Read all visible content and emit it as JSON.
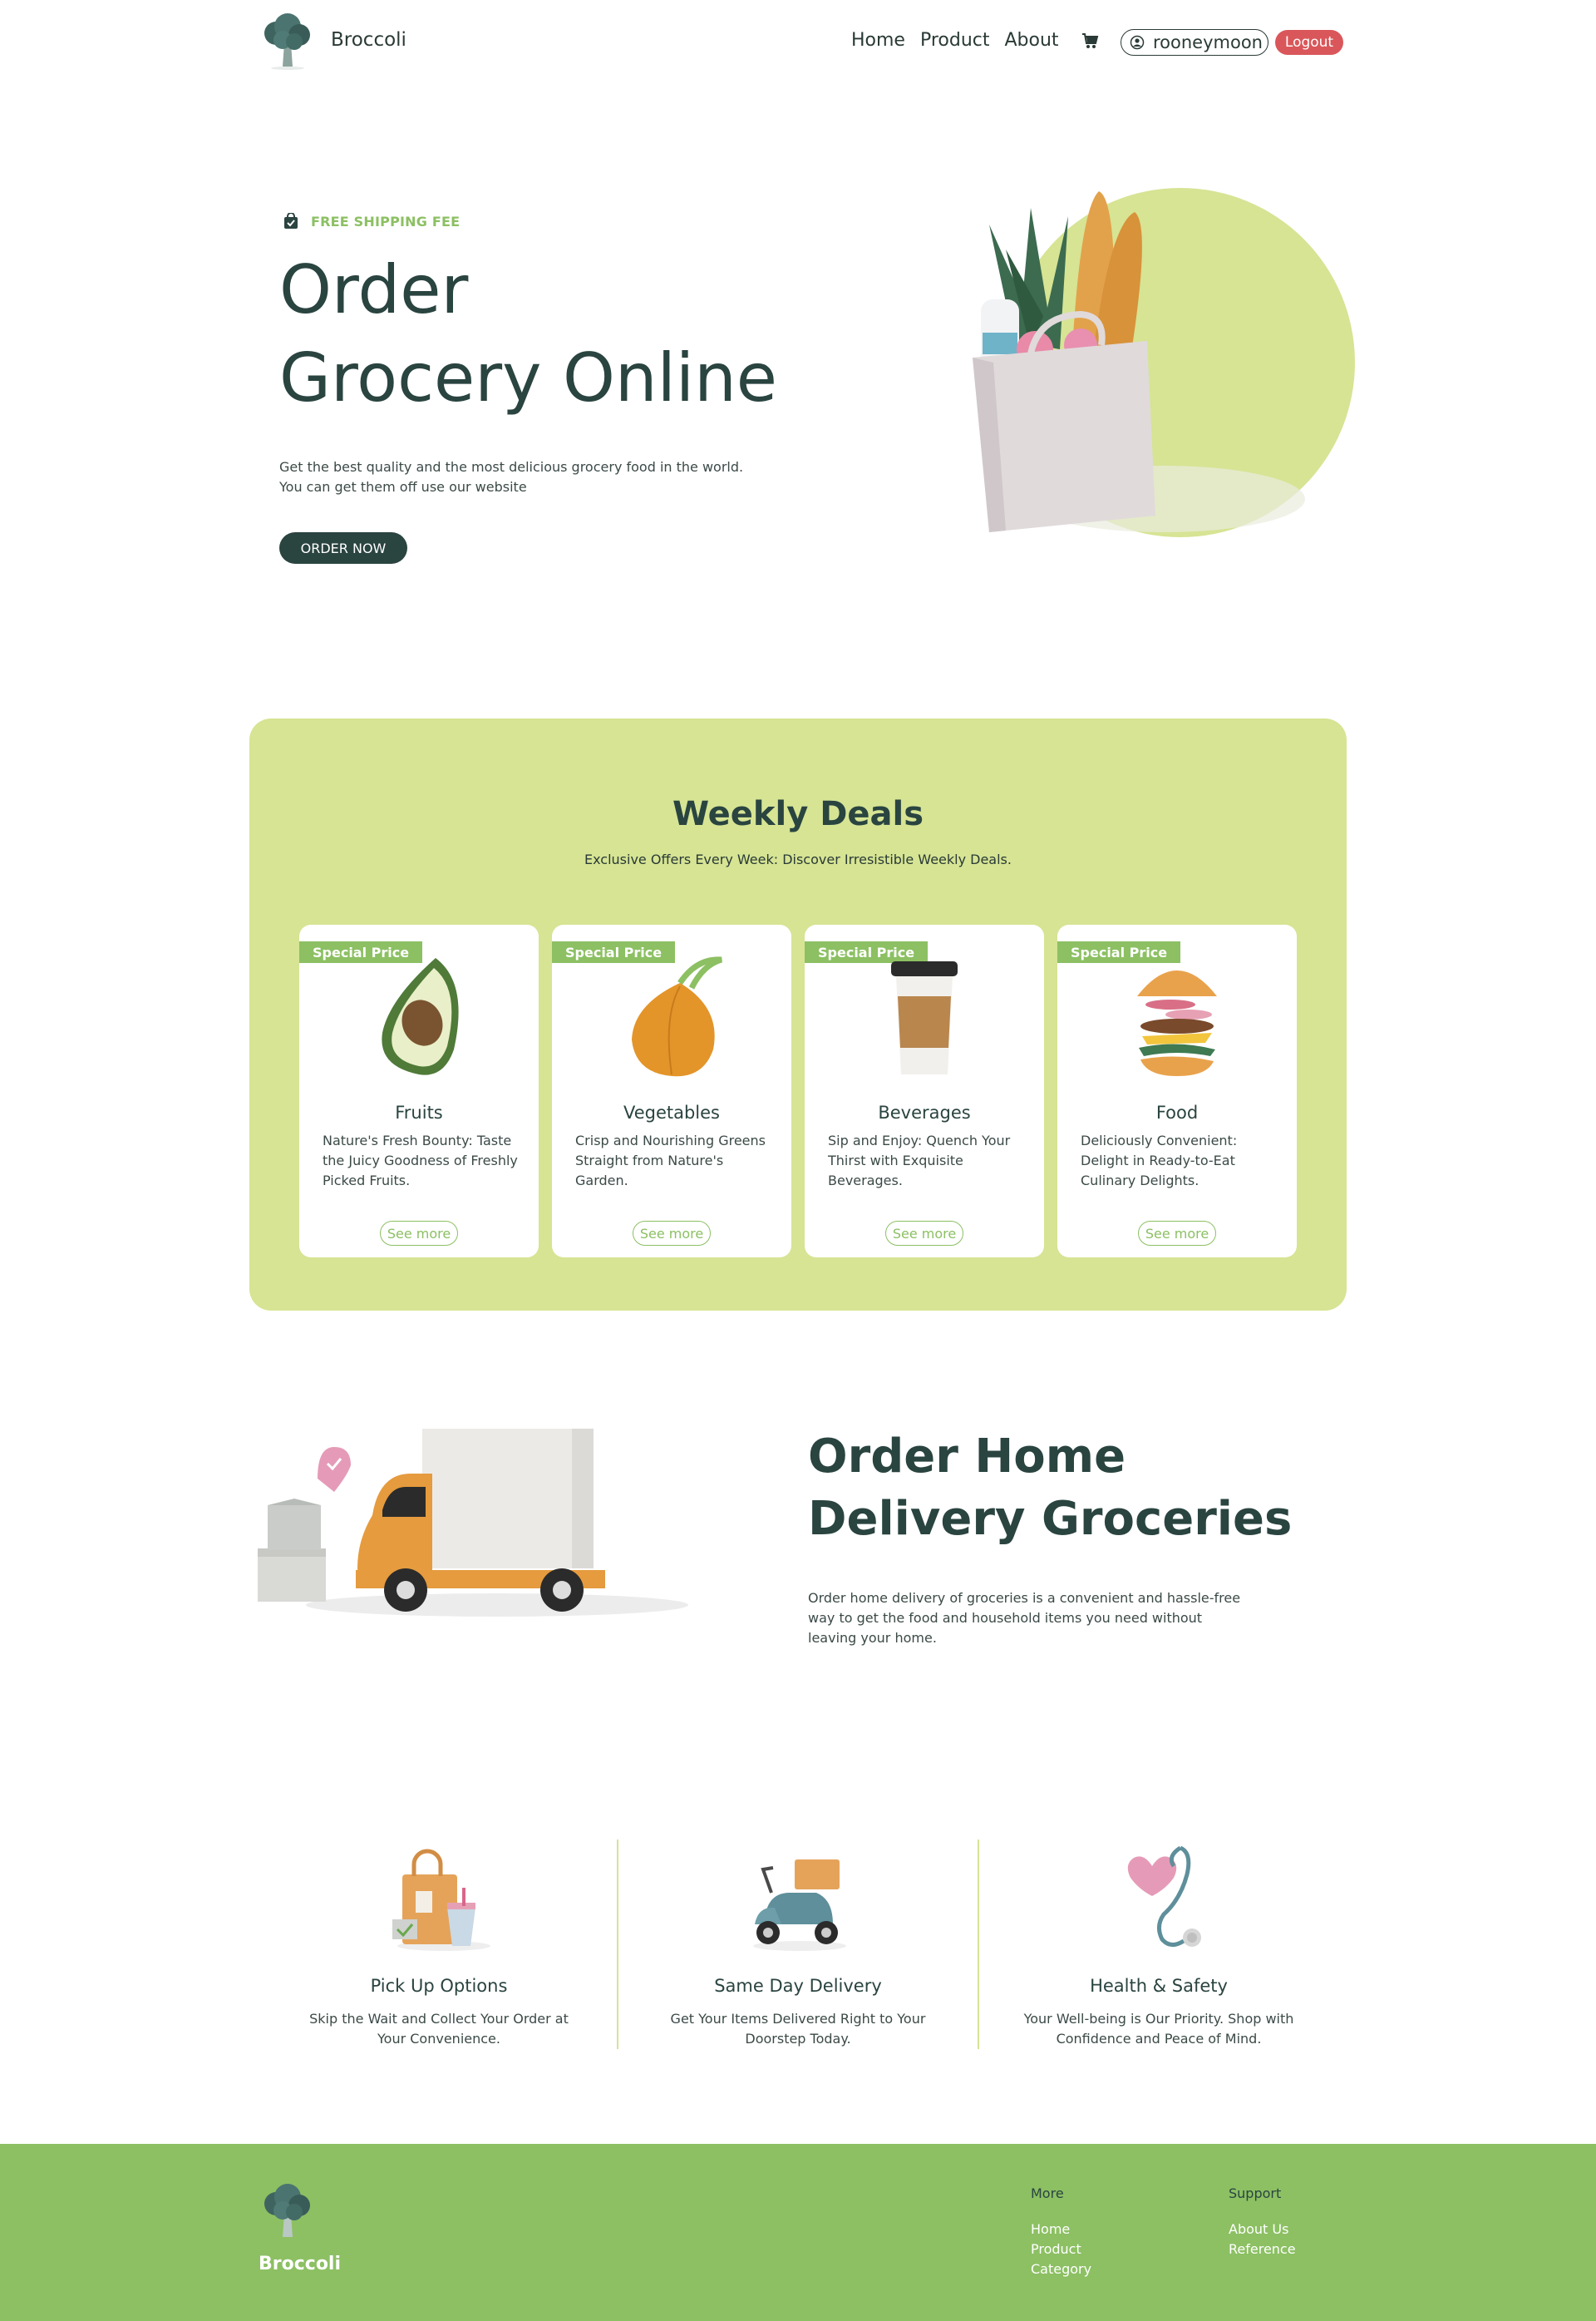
{
  "nav": {
    "brand": "Broccoli",
    "links": [
      "Home",
      "Product",
      "About"
    ],
    "cart_icon": "cart-icon",
    "username": "rooneymoon",
    "logout": "Logout"
  },
  "hero": {
    "badge": "FREE SHIPPING FEE",
    "title_line1": "Order",
    "title_line2": "Grocery Online",
    "subtitle_line1": "Get the best quality and the most delicious grocery food in the world.",
    "subtitle_line2": "You can get them off use our website",
    "cta": "ORDER NOW"
  },
  "deals": {
    "title": "Weekly Deals",
    "subtitle": "Exclusive Offers Every Week: Discover Irresistible Weekly Deals.",
    "cards": [
      {
        "tag": "Special Price",
        "title": "Fruits",
        "desc": "Nature's Fresh Bounty: Taste the Juicy Goodness of Freshly Picked Fruits.",
        "button": "See more",
        "icon": "avocado-icon"
      },
      {
        "tag": "Special Price",
        "title": "Vegetables",
        "desc": "Crisp and Nourishing Greens Straight from Nature's Garden.",
        "button": "See more",
        "icon": "onion-icon"
      },
      {
        "tag": "Special Price",
        "title": "Beverages",
        "desc": "Sip and Enjoy: Quench Your Thirst with Exquisite Beverages.",
        "button": "See more",
        "icon": "coffee-cup-icon"
      },
      {
        "tag": "Special Price",
        "title": "Food",
        "desc": "Deliciously Convenient: Delight in Ready-to-Eat Culinary Delights.",
        "button": "See more",
        "icon": "burger-icon"
      }
    ]
  },
  "delivery": {
    "title_line1": "Order Home",
    "title_line2": "Delivery Groceries",
    "desc": "Order home delivery of groceries is a convenient and hassle-free way to get the food and household items you need without leaving your home."
  },
  "features": [
    {
      "title": "Pick Up Options",
      "desc": "Skip the Wait and Collect Your Order at Your Convenience.",
      "icon": "shopping-bag-icon"
    },
    {
      "title": "Same Day Delivery",
      "desc": "Get Your Items Delivered Right to Your Doorstep Today.",
      "icon": "scooter-icon"
    },
    {
      "title": "Health & Safety",
      "desc": "Your Well-being is Our Priority. Shop with Confidence and Peace of Mind.",
      "icon": "stethoscope-heart-icon"
    }
  ],
  "footer": {
    "brand": "Broccoli",
    "more": {
      "heading": "More",
      "links": [
        "Home",
        "Product",
        "Category"
      ]
    },
    "support": {
      "heading": "Support",
      "links": [
        "About Us",
        "Reference"
      ]
    }
  },
  "colors": {
    "primary_dark": "#2a4440",
    "accent_green": "#8cc063",
    "light_green": "#d6e494",
    "logout_red": "#d9575a"
  }
}
